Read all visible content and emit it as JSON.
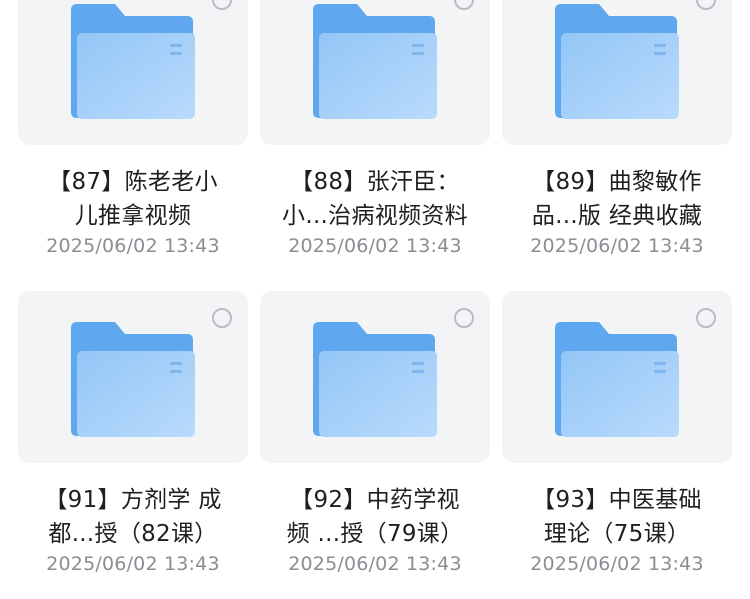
{
  "files": [
    {
      "line1": "【87】陈老老小",
      "line2": "儿推拿视频",
      "date": "2025/06/02 13:43"
    },
    {
      "line1": "【88】张汗臣：",
      "line2": "小...治病视频资料",
      "date": "2025/06/02 13:43"
    },
    {
      "line1": "【89】曲黎敏作",
      "line2": "品...版 经典收藏",
      "date": "2025/06/02 13:43"
    },
    {
      "line1": "【91】方剂学 成",
      "line2": "都...授（82课）",
      "date": "2025/06/02 13:43"
    },
    {
      "line1": "【92】中药学视",
      "line2": "频 ...授（79课）",
      "date": "2025/06/02 13:43"
    },
    {
      "line1": "【93】中医基础",
      "line2": "理论（75课）",
      "date": "2025/06/02 13:43"
    }
  ],
  "colors": {
    "folder_back": "#5fa8f0",
    "folder_front_top": "#9ccbf6",
    "folder_front_bottom": "#b5d8fb",
    "select_ring": "#b9bcc2"
  },
  "icons": {
    "folder": "folder-icon",
    "select": "select-circle-icon"
  }
}
